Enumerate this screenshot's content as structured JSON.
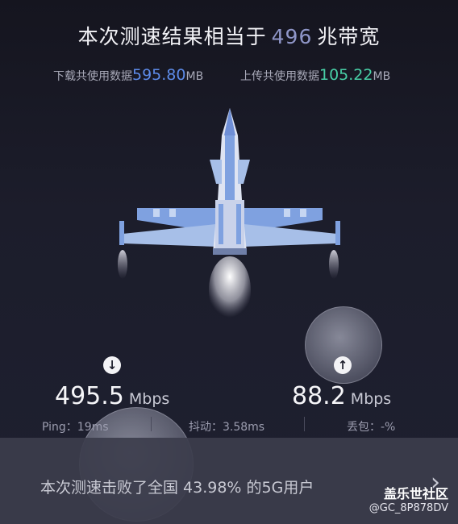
{
  "title": {
    "prefix": "本次测速结果相当于",
    "value": "496",
    "suffix": "兆带宽"
  },
  "usage": {
    "download": {
      "label": "下载共使用数据",
      "value": "595.80",
      "unit": "MB"
    },
    "upload": {
      "label": "上传共使用数据",
      "value": "105.22",
      "unit": "MB"
    }
  },
  "download": {
    "value": "495.5",
    "unit": "Mbps",
    "icon": "download-arrow-icon"
  },
  "upload": {
    "value": "88.2",
    "unit": "Mbps",
    "icon": "upload-arrow-icon"
  },
  "stats": {
    "ping": "Ping：19ms",
    "jitter": "抖动：3.58ms",
    "loss": "丢包：-%"
  },
  "summary": "本次测速击败了全国 43.98% 的5G用户",
  "watermark": {
    "line1": "盖乐世社区",
    "line2": "@GC_8P878DV"
  },
  "colors": {
    "download_accent": "#5d8be8",
    "upload_accent": "#48cfa6",
    "title_accent": "#8f96c8"
  }
}
